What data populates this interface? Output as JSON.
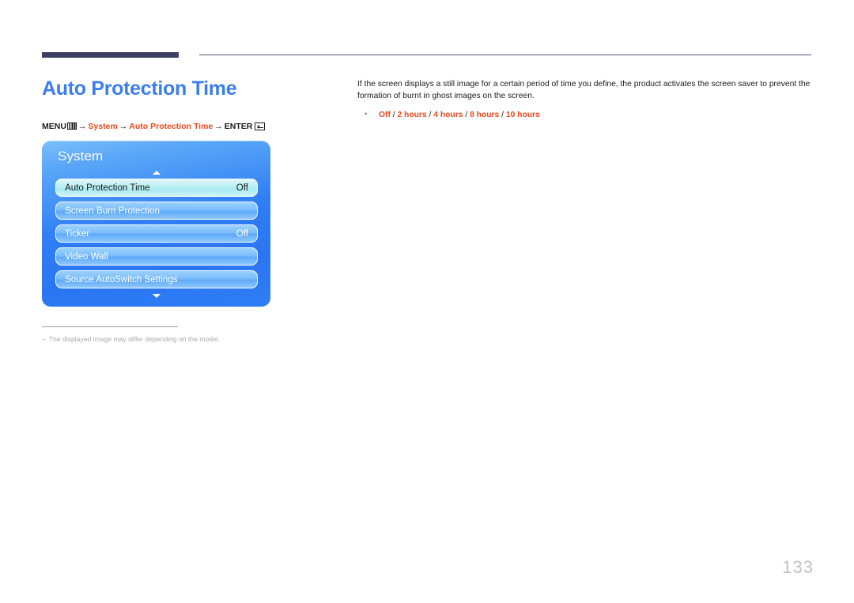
{
  "page": {
    "title": "Auto Protection Time",
    "number": "133"
  },
  "menu_path": {
    "menu_label": "MENU",
    "menu_icon": "menu-bars-icon",
    "arrow": "→",
    "step1": "System",
    "step2": "Auto Protection Time",
    "enter_label": "ENTER",
    "enter_icon": "enter-return-icon"
  },
  "osd": {
    "title": "System",
    "scroll_up_icon": "triangle-up-icon",
    "scroll_down_icon": "triangle-down-icon",
    "rows": [
      {
        "label": "Auto Protection Time",
        "value": "Off",
        "selected": true
      },
      {
        "label": "Screen Burn Protection",
        "value": "",
        "selected": false
      },
      {
        "label": "Ticker",
        "value": "Off",
        "selected": false
      },
      {
        "label": "Video Wall",
        "value": "",
        "selected": false
      },
      {
        "label": "Source AutoSwitch Settings",
        "value": "",
        "selected": false
      }
    ]
  },
  "footnote": {
    "dash": "–",
    "text": "The displayed image may differ depending on the model."
  },
  "description": {
    "body": "If the screen displays a still image for a certain period of time you define, the product activates the screen saver to prevent the formation of burnt in ghost images on the screen.",
    "options": [
      "Off",
      "2 hours",
      "4 hours",
      "8 hours",
      "10 hours"
    ],
    "separator": " / "
  },
  "colors": {
    "title_blue": "#3b7ded",
    "accent_red": "#e8491f",
    "rule_navy": "#3b3f63",
    "osd_blue": "#2f7ef4",
    "osd_selected": "#b7eef2",
    "muted_gray": "#a9a9a9"
  }
}
